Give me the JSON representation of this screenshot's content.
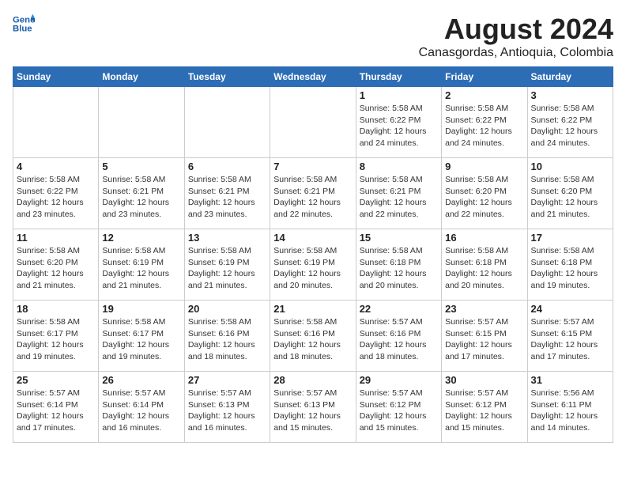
{
  "header": {
    "logo_line1": "General",
    "logo_line2": "Blue",
    "title": "August 2024",
    "subtitle": "Canasgordas, Antioquia, Colombia"
  },
  "calendar": {
    "weekdays": [
      "Sunday",
      "Monday",
      "Tuesday",
      "Wednesday",
      "Thursday",
      "Friday",
      "Saturday"
    ],
    "weeks": [
      [
        {
          "day": "",
          "info": ""
        },
        {
          "day": "",
          "info": ""
        },
        {
          "day": "",
          "info": ""
        },
        {
          "day": "",
          "info": ""
        },
        {
          "day": "1",
          "info": "Sunrise: 5:58 AM\nSunset: 6:22 PM\nDaylight: 12 hours\nand 24 minutes."
        },
        {
          "day": "2",
          "info": "Sunrise: 5:58 AM\nSunset: 6:22 PM\nDaylight: 12 hours\nand 24 minutes."
        },
        {
          "day": "3",
          "info": "Sunrise: 5:58 AM\nSunset: 6:22 PM\nDaylight: 12 hours\nand 24 minutes."
        }
      ],
      [
        {
          "day": "4",
          "info": "Sunrise: 5:58 AM\nSunset: 6:22 PM\nDaylight: 12 hours\nand 23 minutes."
        },
        {
          "day": "5",
          "info": "Sunrise: 5:58 AM\nSunset: 6:21 PM\nDaylight: 12 hours\nand 23 minutes."
        },
        {
          "day": "6",
          "info": "Sunrise: 5:58 AM\nSunset: 6:21 PM\nDaylight: 12 hours\nand 23 minutes."
        },
        {
          "day": "7",
          "info": "Sunrise: 5:58 AM\nSunset: 6:21 PM\nDaylight: 12 hours\nand 22 minutes."
        },
        {
          "day": "8",
          "info": "Sunrise: 5:58 AM\nSunset: 6:21 PM\nDaylight: 12 hours\nand 22 minutes."
        },
        {
          "day": "9",
          "info": "Sunrise: 5:58 AM\nSunset: 6:20 PM\nDaylight: 12 hours\nand 22 minutes."
        },
        {
          "day": "10",
          "info": "Sunrise: 5:58 AM\nSunset: 6:20 PM\nDaylight: 12 hours\nand 21 minutes."
        }
      ],
      [
        {
          "day": "11",
          "info": "Sunrise: 5:58 AM\nSunset: 6:20 PM\nDaylight: 12 hours\nand 21 minutes."
        },
        {
          "day": "12",
          "info": "Sunrise: 5:58 AM\nSunset: 6:19 PM\nDaylight: 12 hours\nand 21 minutes."
        },
        {
          "day": "13",
          "info": "Sunrise: 5:58 AM\nSunset: 6:19 PM\nDaylight: 12 hours\nand 21 minutes."
        },
        {
          "day": "14",
          "info": "Sunrise: 5:58 AM\nSunset: 6:19 PM\nDaylight: 12 hours\nand 20 minutes."
        },
        {
          "day": "15",
          "info": "Sunrise: 5:58 AM\nSunset: 6:18 PM\nDaylight: 12 hours\nand 20 minutes."
        },
        {
          "day": "16",
          "info": "Sunrise: 5:58 AM\nSunset: 6:18 PM\nDaylight: 12 hours\nand 20 minutes."
        },
        {
          "day": "17",
          "info": "Sunrise: 5:58 AM\nSunset: 6:18 PM\nDaylight: 12 hours\nand 19 minutes."
        }
      ],
      [
        {
          "day": "18",
          "info": "Sunrise: 5:58 AM\nSunset: 6:17 PM\nDaylight: 12 hours\nand 19 minutes."
        },
        {
          "day": "19",
          "info": "Sunrise: 5:58 AM\nSunset: 6:17 PM\nDaylight: 12 hours\nand 19 minutes."
        },
        {
          "day": "20",
          "info": "Sunrise: 5:58 AM\nSunset: 6:16 PM\nDaylight: 12 hours\nand 18 minutes."
        },
        {
          "day": "21",
          "info": "Sunrise: 5:58 AM\nSunset: 6:16 PM\nDaylight: 12 hours\nand 18 minutes."
        },
        {
          "day": "22",
          "info": "Sunrise: 5:57 AM\nSunset: 6:16 PM\nDaylight: 12 hours\nand 18 minutes."
        },
        {
          "day": "23",
          "info": "Sunrise: 5:57 AM\nSunset: 6:15 PM\nDaylight: 12 hours\nand 17 minutes."
        },
        {
          "day": "24",
          "info": "Sunrise: 5:57 AM\nSunset: 6:15 PM\nDaylight: 12 hours\nand 17 minutes."
        }
      ],
      [
        {
          "day": "25",
          "info": "Sunrise: 5:57 AM\nSunset: 6:14 PM\nDaylight: 12 hours\nand 17 minutes."
        },
        {
          "day": "26",
          "info": "Sunrise: 5:57 AM\nSunset: 6:14 PM\nDaylight: 12 hours\nand 16 minutes."
        },
        {
          "day": "27",
          "info": "Sunrise: 5:57 AM\nSunset: 6:13 PM\nDaylight: 12 hours\nand 16 minutes."
        },
        {
          "day": "28",
          "info": "Sunrise: 5:57 AM\nSunset: 6:13 PM\nDaylight: 12 hours\nand 15 minutes."
        },
        {
          "day": "29",
          "info": "Sunrise: 5:57 AM\nSunset: 6:12 PM\nDaylight: 12 hours\nand 15 minutes."
        },
        {
          "day": "30",
          "info": "Sunrise: 5:57 AM\nSunset: 6:12 PM\nDaylight: 12 hours\nand 15 minutes."
        },
        {
          "day": "31",
          "info": "Sunrise: 5:56 AM\nSunset: 6:11 PM\nDaylight: 12 hours\nand 14 minutes."
        }
      ]
    ]
  }
}
